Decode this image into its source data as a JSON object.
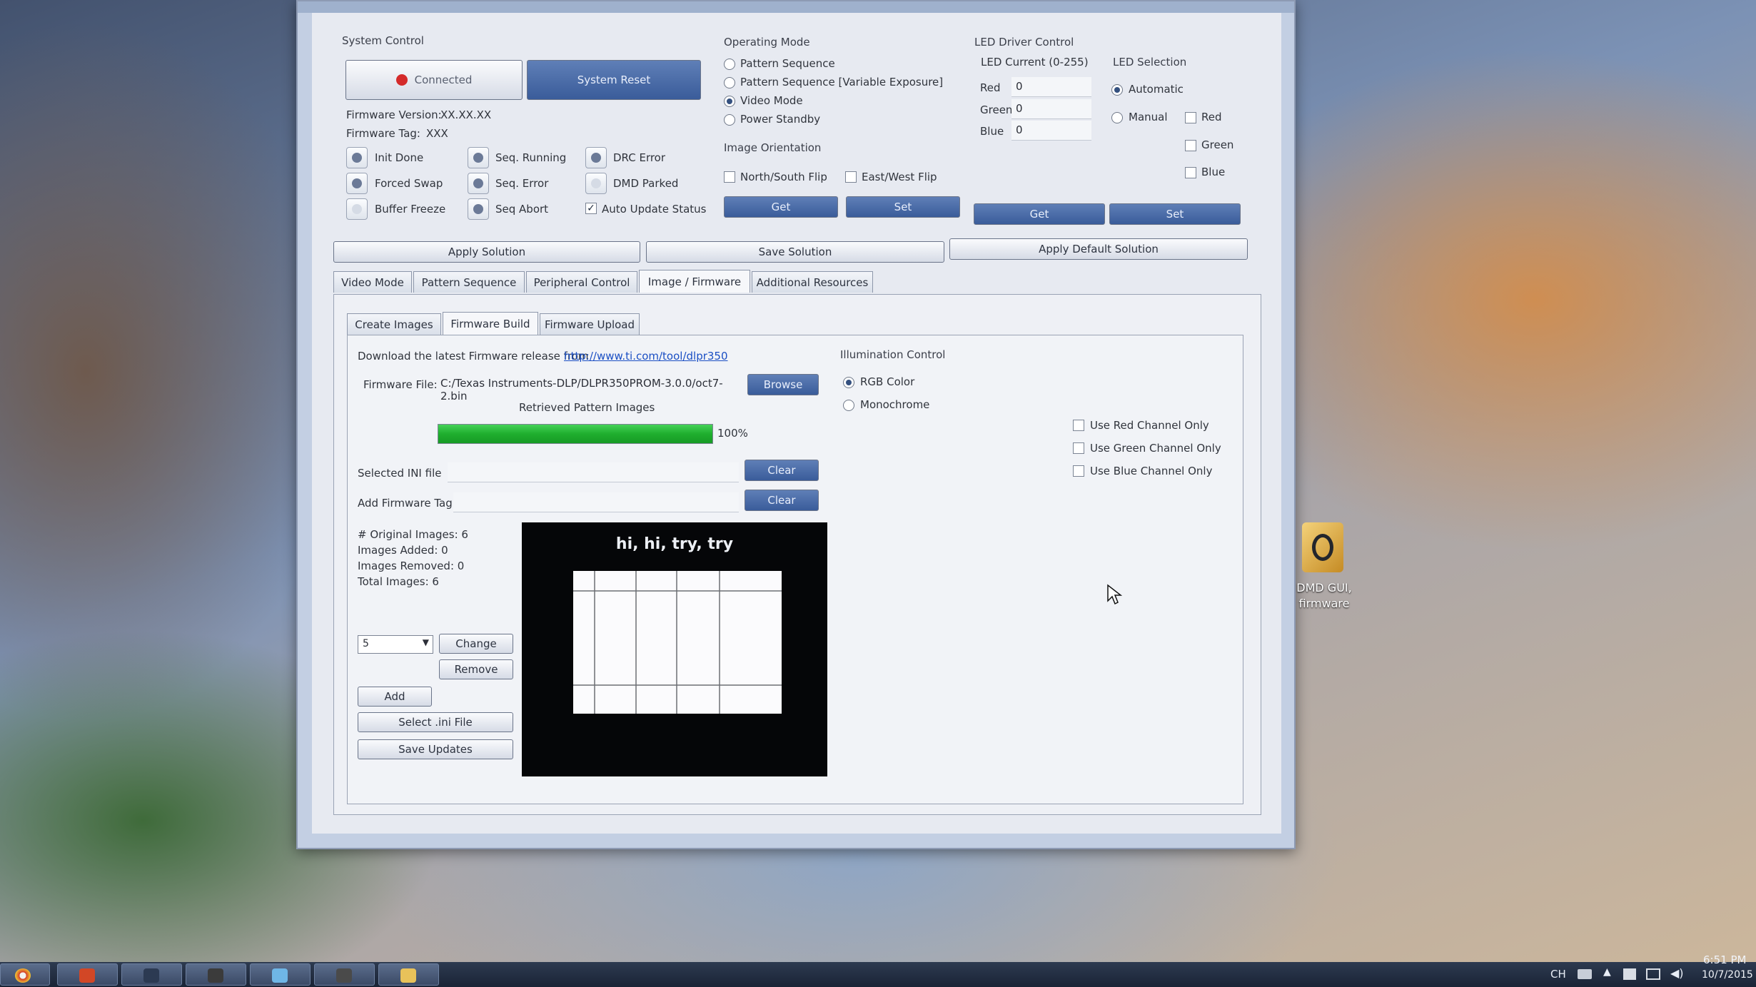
{
  "system_control": {
    "title": "System Control",
    "connected_label": "Connected",
    "reset_label": "System Reset",
    "firmware_version_label": "Firmware Version:",
    "firmware_version_value": "XX.XX.XX",
    "firmware_tag_label": "Firmware Tag:",
    "firmware_tag_value": "XXX",
    "indicators": [
      "Init Done",
      "Seq. Running",
      "DRC Error",
      "Forced Swap",
      "Seq. Error",
      "DMD Parked",
      "Buffer Freeze",
      "Seq Abort"
    ],
    "auto_update_label": "Auto Update Status"
  },
  "operating_mode": {
    "title": "Operating Mode",
    "options": [
      "Pattern Sequence",
      "Pattern Sequence [Variable Exposure]",
      "Video Mode",
      "Power Standby"
    ],
    "selected": "Video Mode"
  },
  "image_orientation": {
    "title": "Image Orientation",
    "ns_flip": "North/South Flip",
    "ew_flip": "East/West Flip",
    "get_label": "Get",
    "set_label": "Set"
  },
  "led_driver": {
    "title": "LED Driver Control",
    "current_title": "LED Current (0-255)",
    "red_label": "Red",
    "red_value": "0",
    "green_label": "Green",
    "green_value": "0",
    "blue_label": "Blue",
    "blue_value": "0",
    "selection_title": "LED Selection",
    "automatic_label": "Automatic",
    "manual_label": "Manual",
    "sel_red": "Red",
    "sel_green": "Green",
    "sel_blue": "Blue",
    "get_label": "Get",
    "set_label": "Set"
  },
  "solution_buttons": {
    "apply": "Apply Solution",
    "save": "Save Solution",
    "apply_default": "Apply Default Solution"
  },
  "main_tabs": [
    "Video Mode",
    "Pattern Sequence",
    "Peripheral Control",
    "Image / Firmware",
    "Additional Resources"
  ],
  "sub_tabs": [
    "Create Images",
    "Firmware Build",
    "Firmware Upload"
  ],
  "firmware_build": {
    "download_text": "Download the latest Firmware release from",
    "download_link": "http://www.ti.com/tool/dlpr350",
    "firmware_file_label": "Firmware File:",
    "firmware_file_value": "C:/Texas Instruments-DLP/DLPR350PROM-3.0.0/oct7-2.bin",
    "browse_label": "Browse",
    "retrieved_label": "Retrieved Pattern Images",
    "progress": 1.0,
    "progress_text": "100%",
    "ini_label": "Selected INI file",
    "tag_label": "Add Firmware Tag",
    "clear_label": "Clear",
    "original_images": "# Original Images: 6",
    "images_added": "Images Added: 0",
    "images_removed": "Images Removed: 0",
    "total_images": "Total Images: 6",
    "image_index": "5",
    "change_label": "Change",
    "remove_label": "Remove",
    "add_label": "Add",
    "select_ini_label": "Select .ini File",
    "save_updates_label": "Save Updates",
    "preview_caption": "hi, hi, try, try"
  },
  "illumination": {
    "title": "Illumination Control",
    "rgb_label": "RGB Color",
    "mono_label": "Monochrome",
    "red_only": "Use Red Channel Only",
    "green_only": "Use Green Channel Only",
    "blue_only": "Use Blue Channel Only"
  },
  "desktop_icon": {
    "label_line1": "DMD GUI,",
    "label_line2": "firmware"
  },
  "taskbar": {
    "lang": "CH",
    "time": "6:51 PM",
    "date": "10/7/2015"
  },
  "colors": {
    "progress": "#1fae2e",
    "connected_dot": "#d42a2a",
    "window_bg": "#e7eaf1"
  }
}
